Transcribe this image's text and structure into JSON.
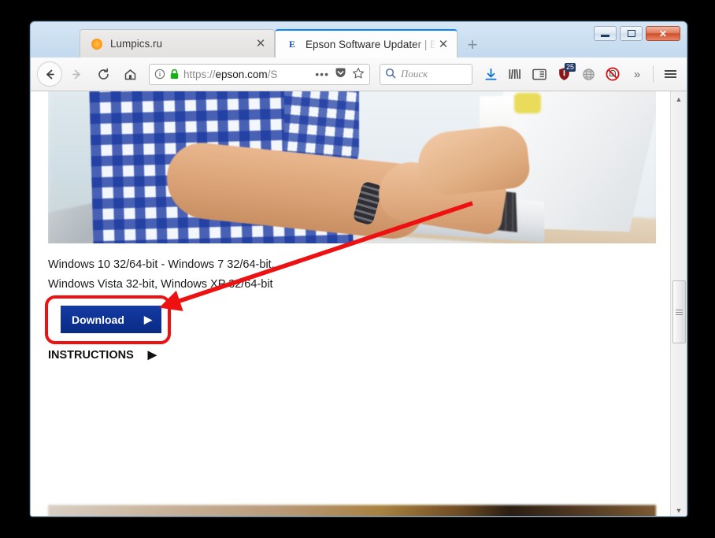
{
  "window": {
    "controls": {
      "minimize_label": "Minimize",
      "maximize_label": "Maximize",
      "close_label": "✕"
    }
  },
  "tabs": [
    {
      "label": "Lumpics.ru",
      "favicon": "orange-circle-icon",
      "active": false,
      "close_label": "✕"
    },
    {
      "label": "Epson Software Updater | Epson",
      "favicon": "epson-e-icon",
      "active": true,
      "close_label": "✕"
    }
  ],
  "new_tab_label": "+",
  "toolbar": {
    "back_label": "Back",
    "forward_label": "Forward",
    "reload_label": "Reload",
    "home_label": "Home",
    "identity_icon": "info-circle-icon",
    "lock_icon": "padlock-icon",
    "url_prefix": "https://",
    "url_domain": "epson.com",
    "url_suffix": "/S",
    "page_actions_label": "•••",
    "pocket_label": "Save to Pocket",
    "bookmark_label": "Bookmark this page",
    "downloads_label": "Downloads",
    "library_label": "Library",
    "sidebar_label": "Sidebar",
    "ublock_count": "25",
    "globe_label": "Globe",
    "adblock_label": "Adblock",
    "overflow_label": "»",
    "menu_label": "Open menu"
  },
  "search": {
    "placeholder": "Поиск",
    "icon": "search-icon"
  },
  "page": {
    "hero_alt": "Man in blue checkered shirt typing on a white laptop",
    "system_requirements_line1": "Windows 10 32/64-bit - Windows 7 32/64-bit,",
    "system_requirements_line2": "Windows Vista 32-bit, Windows XP 32/64-bit",
    "download_button_label": "Download",
    "download_button_arrow": "▶",
    "instructions_label": "INSTRUCTIONS",
    "instructions_arrow": "▶"
  },
  "scrollbar": {
    "up_arrow": "▲",
    "down_arrow": "▼"
  },
  "annotation": {
    "highlight_color": "#ee1111",
    "arrow_color": "#ee1111",
    "arrow_from": "600,258",
    "arrow_to": "215,387"
  },
  "colors": {
    "download_blue": "#0a2b86",
    "annotation_red": "#ee1111",
    "tab_accent": "#0a84ff"
  }
}
